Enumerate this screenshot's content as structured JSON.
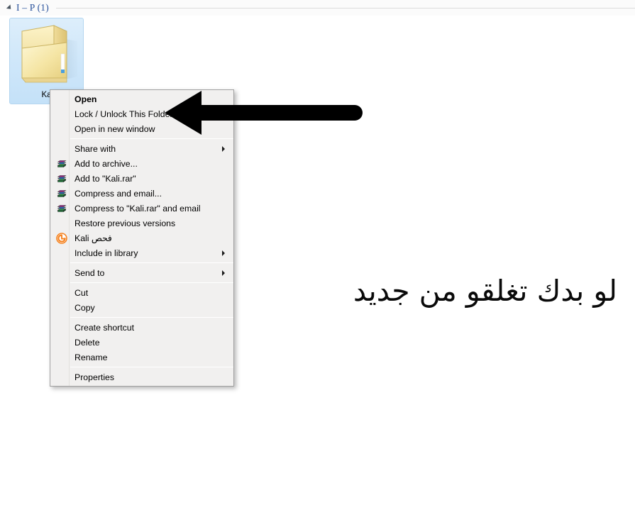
{
  "window": {
    "background_color": "#ffffff",
    "group_header": {
      "title": "I – P (1)",
      "collapse_icon": "triangle-collapse-icon",
      "title_color": "#27509b"
    }
  },
  "folder_item": {
    "label": "Ka",
    "full_name": "Kali",
    "icon": "open-folder-icon",
    "selected": true,
    "selection_border_color": "#b4d6f0",
    "selection_fill_color": "#cfe7fa"
  },
  "context_menu": {
    "background_color": "#f1f0ef",
    "border_color": "#a0a0a0",
    "groups": [
      {
        "items": [
          {
            "label": "Open",
            "bold": true,
            "icon": null,
            "submenu": false
          },
          {
            "label": "Lock / Unlock This Folder",
            "bold": false,
            "icon": null,
            "submenu": false
          },
          {
            "label": "Open in new window",
            "bold": false,
            "icon": null,
            "submenu": false
          }
        ]
      },
      {
        "items": [
          {
            "label": "Share with",
            "bold": false,
            "icon": null,
            "submenu": true
          },
          {
            "label": "Add to archive...",
            "bold": false,
            "icon": "winrar-books-icon",
            "submenu": false
          },
          {
            "label": "Add to \"Kali.rar\"",
            "bold": false,
            "icon": "winrar-books-icon",
            "submenu": false
          },
          {
            "label": "Compress and email...",
            "bold": false,
            "icon": "winrar-books-icon",
            "submenu": false
          },
          {
            "label": "Compress to \"Kali.rar\" and email",
            "bold": false,
            "icon": "winrar-books-icon",
            "submenu": false
          },
          {
            "label": "Restore previous versions",
            "bold": false,
            "icon": null,
            "submenu": false
          },
          {
            "label": "فحص Kali",
            "bold": false,
            "icon": "avast-scan-icon",
            "submenu": false
          },
          {
            "label": "Include in library",
            "bold": false,
            "icon": null,
            "submenu": true
          }
        ]
      },
      {
        "items": [
          {
            "label": "Send to",
            "bold": false,
            "icon": null,
            "submenu": true
          }
        ]
      },
      {
        "items": [
          {
            "label": "Cut",
            "bold": false,
            "icon": null,
            "submenu": false
          },
          {
            "label": "Copy",
            "bold": false,
            "icon": null,
            "submenu": false
          }
        ]
      },
      {
        "items": [
          {
            "label": "Create shortcut",
            "bold": false,
            "icon": null,
            "submenu": false
          },
          {
            "label": "Delete",
            "bold": false,
            "icon": null,
            "submenu": false
          },
          {
            "label": "Rename",
            "bold": false,
            "icon": null,
            "submenu": false
          }
        ]
      },
      {
        "items": [
          {
            "label": "Properties",
            "bold": false,
            "icon": null,
            "submenu": false
          }
        ]
      }
    ]
  },
  "annotation": {
    "arrow": {
      "icon": "left-pointing-arrow",
      "color": "#000000",
      "points_at": "Lock / Unlock This Folder"
    },
    "caption": {
      "text": "لو بدك تغلقو من جديد",
      "color": "#0a0a0a",
      "direction": "rtl"
    }
  }
}
